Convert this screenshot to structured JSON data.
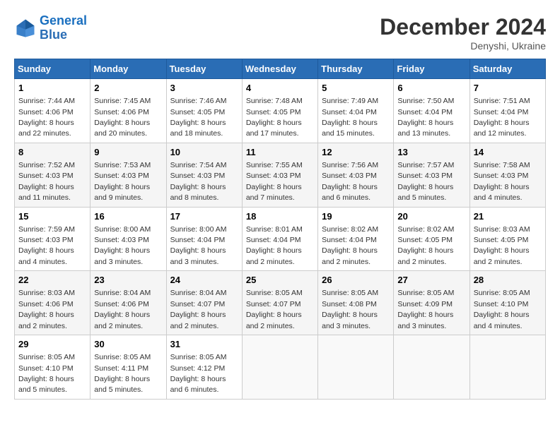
{
  "header": {
    "logo_line1": "General",
    "logo_line2": "Blue",
    "month": "December 2024",
    "location": "Denyshi, Ukraine"
  },
  "days_of_week": [
    "Sunday",
    "Monday",
    "Tuesday",
    "Wednesday",
    "Thursday",
    "Friday",
    "Saturday"
  ],
  "weeks": [
    [
      {
        "day": "1",
        "info": "Sunrise: 7:44 AM\nSunset: 4:06 PM\nDaylight: 8 hours and 22 minutes."
      },
      {
        "day": "2",
        "info": "Sunrise: 7:45 AM\nSunset: 4:06 PM\nDaylight: 8 hours and 20 minutes."
      },
      {
        "day": "3",
        "info": "Sunrise: 7:46 AM\nSunset: 4:05 PM\nDaylight: 8 hours and 18 minutes."
      },
      {
        "day": "4",
        "info": "Sunrise: 7:48 AM\nSunset: 4:05 PM\nDaylight: 8 hours and 17 minutes."
      },
      {
        "day": "5",
        "info": "Sunrise: 7:49 AM\nSunset: 4:04 PM\nDaylight: 8 hours and 15 minutes."
      },
      {
        "day": "6",
        "info": "Sunrise: 7:50 AM\nSunset: 4:04 PM\nDaylight: 8 hours and 13 minutes."
      },
      {
        "day": "7",
        "info": "Sunrise: 7:51 AM\nSunset: 4:04 PM\nDaylight: 8 hours and 12 minutes."
      }
    ],
    [
      {
        "day": "8",
        "info": "Sunrise: 7:52 AM\nSunset: 4:03 PM\nDaylight: 8 hours and 11 minutes."
      },
      {
        "day": "9",
        "info": "Sunrise: 7:53 AM\nSunset: 4:03 PM\nDaylight: 8 hours and 9 minutes."
      },
      {
        "day": "10",
        "info": "Sunrise: 7:54 AM\nSunset: 4:03 PM\nDaylight: 8 hours and 8 minutes."
      },
      {
        "day": "11",
        "info": "Sunrise: 7:55 AM\nSunset: 4:03 PM\nDaylight: 8 hours and 7 minutes."
      },
      {
        "day": "12",
        "info": "Sunrise: 7:56 AM\nSunset: 4:03 PM\nDaylight: 8 hours and 6 minutes."
      },
      {
        "day": "13",
        "info": "Sunrise: 7:57 AM\nSunset: 4:03 PM\nDaylight: 8 hours and 5 minutes."
      },
      {
        "day": "14",
        "info": "Sunrise: 7:58 AM\nSunset: 4:03 PM\nDaylight: 8 hours and 4 minutes."
      }
    ],
    [
      {
        "day": "15",
        "info": "Sunrise: 7:59 AM\nSunset: 4:03 PM\nDaylight: 8 hours and 4 minutes."
      },
      {
        "day": "16",
        "info": "Sunrise: 8:00 AM\nSunset: 4:03 PM\nDaylight: 8 hours and 3 minutes."
      },
      {
        "day": "17",
        "info": "Sunrise: 8:00 AM\nSunset: 4:04 PM\nDaylight: 8 hours and 3 minutes."
      },
      {
        "day": "18",
        "info": "Sunrise: 8:01 AM\nSunset: 4:04 PM\nDaylight: 8 hours and 2 minutes."
      },
      {
        "day": "19",
        "info": "Sunrise: 8:02 AM\nSunset: 4:04 PM\nDaylight: 8 hours and 2 minutes."
      },
      {
        "day": "20",
        "info": "Sunrise: 8:02 AM\nSunset: 4:05 PM\nDaylight: 8 hours and 2 minutes."
      },
      {
        "day": "21",
        "info": "Sunrise: 8:03 AM\nSunset: 4:05 PM\nDaylight: 8 hours and 2 minutes."
      }
    ],
    [
      {
        "day": "22",
        "info": "Sunrise: 8:03 AM\nSunset: 4:06 PM\nDaylight: 8 hours and 2 minutes."
      },
      {
        "day": "23",
        "info": "Sunrise: 8:04 AM\nSunset: 4:06 PM\nDaylight: 8 hours and 2 minutes."
      },
      {
        "day": "24",
        "info": "Sunrise: 8:04 AM\nSunset: 4:07 PM\nDaylight: 8 hours and 2 minutes."
      },
      {
        "day": "25",
        "info": "Sunrise: 8:05 AM\nSunset: 4:07 PM\nDaylight: 8 hours and 2 minutes."
      },
      {
        "day": "26",
        "info": "Sunrise: 8:05 AM\nSunset: 4:08 PM\nDaylight: 8 hours and 3 minutes."
      },
      {
        "day": "27",
        "info": "Sunrise: 8:05 AM\nSunset: 4:09 PM\nDaylight: 8 hours and 3 minutes."
      },
      {
        "day": "28",
        "info": "Sunrise: 8:05 AM\nSunset: 4:10 PM\nDaylight: 8 hours and 4 minutes."
      }
    ],
    [
      {
        "day": "29",
        "info": "Sunrise: 8:05 AM\nSunset: 4:10 PM\nDaylight: 8 hours and 5 minutes."
      },
      {
        "day": "30",
        "info": "Sunrise: 8:05 AM\nSunset: 4:11 PM\nDaylight: 8 hours and 5 minutes."
      },
      {
        "day": "31",
        "info": "Sunrise: 8:05 AM\nSunset: 4:12 PM\nDaylight: 8 hours and 6 minutes."
      },
      null,
      null,
      null,
      null
    ]
  ]
}
